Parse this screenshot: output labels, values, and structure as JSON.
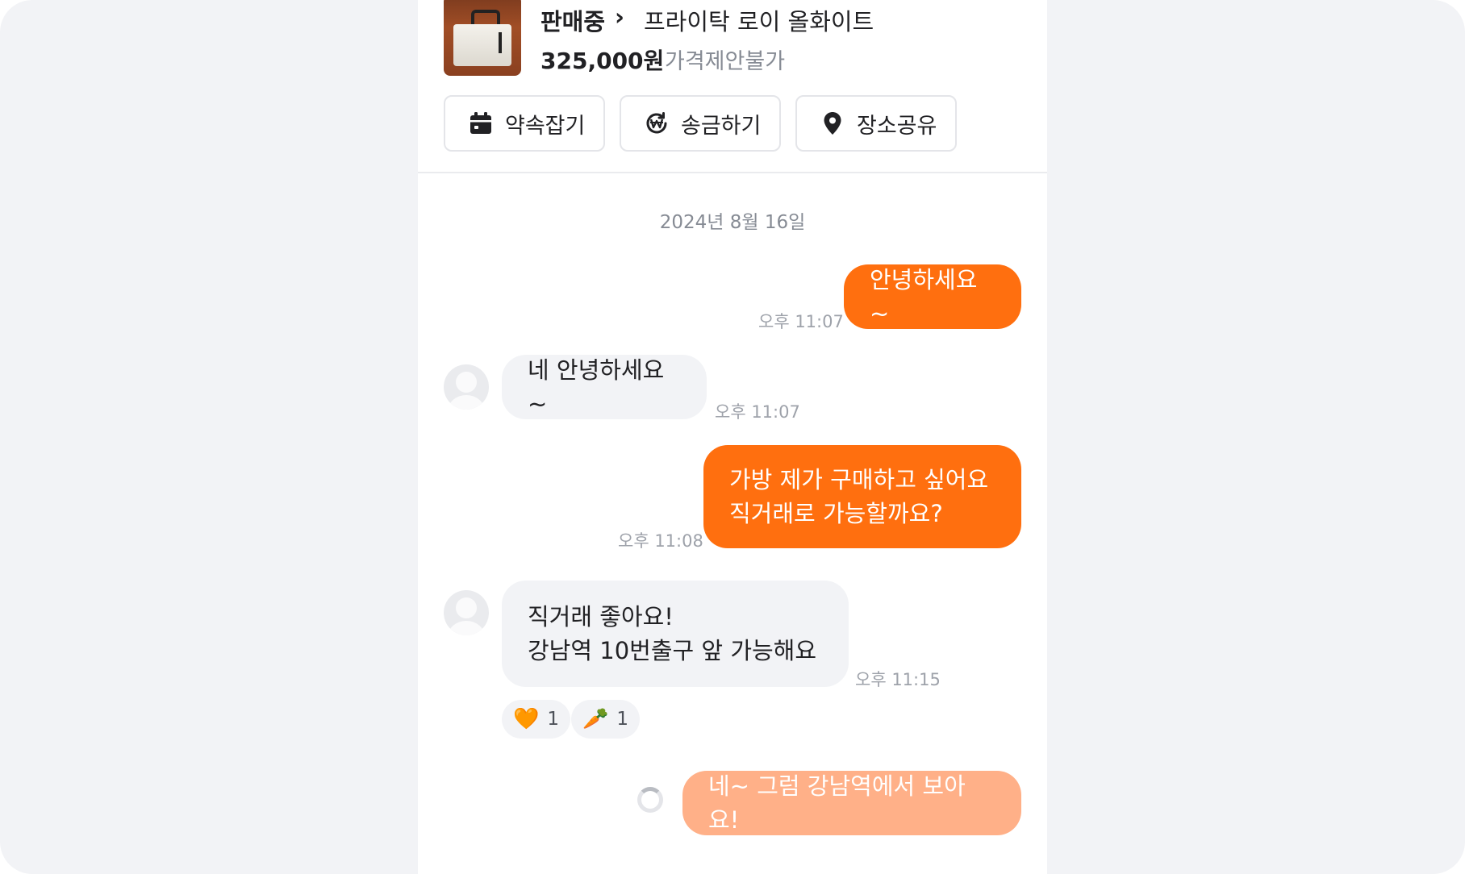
{
  "product": {
    "status": "판매중",
    "chevron": "›",
    "title": "프라이탁 로이 올화이트",
    "price": "325,000원",
    "negotiation": "가격제안불가"
  },
  "actions": [
    {
      "label": "약속잡기",
      "icon": "calendar-icon"
    },
    {
      "label": "송금하기",
      "icon": "won-transfer-icon"
    },
    {
      "label": "장소공유",
      "icon": "location-pin-icon"
    }
  ],
  "chat": {
    "date": "2024년 8월 16일",
    "messages": [
      {
        "sender": "me",
        "lines": [
          "안녕하세요~"
        ],
        "time": "오후 11:07"
      },
      {
        "sender": "them",
        "lines": [
          "네 안녕하세요~"
        ],
        "time": "오후 11:07"
      },
      {
        "sender": "me",
        "lines": [
          "가방 제가 구매하고 싶어요",
          "직거래로 가능할까요?"
        ],
        "time": "오후 11:08"
      },
      {
        "sender": "them",
        "lines": [
          "직거래 좋아요!",
          "강남역 10번출구 앞 가능해요"
        ],
        "time": "오후 11:15",
        "reactions": [
          {
            "emoji": "🧡",
            "count": "1"
          },
          {
            "emoji": "🥕",
            "count": "1"
          }
        ]
      },
      {
        "sender": "me",
        "lines": [
          "네~ 그럼 강남역에서 보아요!"
        ],
        "status": "sending"
      }
    ]
  },
  "colors": {
    "brand": "#ff6f0f",
    "pending": "#ffb088",
    "incoming_bubble": "#f2f3f6",
    "muted_text": "#868b94"
  }
}
